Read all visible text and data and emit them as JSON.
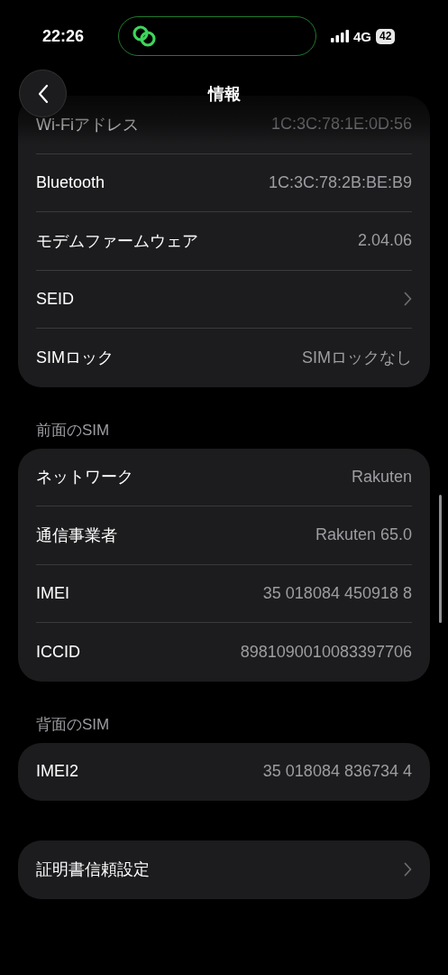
{
  "status_bar": {
    "time": "22:26",
    "network": "4G",
    "battery": "42"
  },
  "nav": {
    "title": "情報"
  },
  "sections": [
    {
      "rows": [
        {
          "kind": "value",
          "label": "Wi-Fiアドレス",
          "value": "1C:3C:78:1E:0D:56"
        },
        {
          "kind": "value",
          "label": "Bluetooth",
          "value": "1C:3C:78:2B:BE:B9"
        },
        {
          "kind": "value",
          "label": "モデムファームウェア",
          "value": "2.04.06"
        },
        {
          "kind": "link",
          "label": "SEID"
        },
        {
          "kind": "value",
          "label": "SIMロック",
          "value": "SIMロックなし"
        }
      ]
    },
    {
      "header": "前面のSIM",
      "rows": [
        {
          "kind": "value",
          "label": "ネットワーク",
          "value": "Rakuten"
        },
        {
          "kind": "value",
          "label": "通信事業者",
          "value": "Rakuten 65.0"
        },
        {
          "kind": "value",
          "label": "IMEI",
          "value": "35 018084 450918 8"
        },
        {
          "kind": "value",
          "label": "ICCID",
          "value": "8981090010083397706"
        }
      ]
    },
    {
      "header": "背面のSIM",
      "rows": [
        {
          "kind": "value",
          "label": "IMEI2",
          "value": "35 018084 836734 4"
        }
      ]
    },
    {
      "rows": [
        {
          "kind": "link",
          "label": "証明書信頼設定"
        }
      ]
    }
  ]
}
